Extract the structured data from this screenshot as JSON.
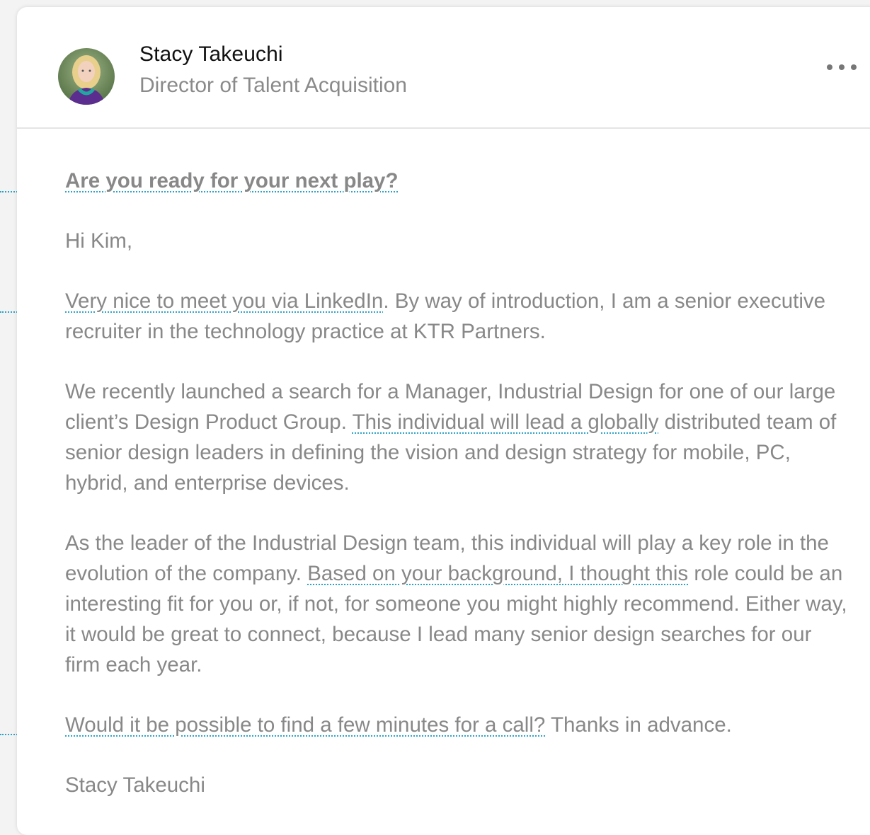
{
  "sender": {
    "name": "Stacy Takeuchi",
    "title": "Director of Talent Acquisition"
  },
  "menu": {
    "icon": "more-horizontal-icon"
  },
  "message": {
    "subject": "Are you ready for your next play?",
    "greeting": "Hi Kim,",
    "p1_highlight": "Very nice to meet you via LinkedIn",
    "p1_rest": ". By way of introduction, I am a senior executive recruiter in the technology practice at KTR Partners.",
    "p2_start": "We recently launched a search for a Manager, Industrial Design for one of our large client’s Design Product Group. ",
    "p2_highlight": "This individual will lead a globally",
    "p2_rest": " distributed team of senior design leaders in defining the vision and design strategy for mobile, PC, hybrid, and enterprise devices.",
    "p3_start": "As the leader of the Industrial Design team, this individual will play a key role in the evolution of the company. ",
    "p3_highlight": "Based on your background, I thought this",
    "p3_rest": " role could be an interesting fit for you or, if not, for someone you might highly recommend. Either way, it would be great to connect, because I lead many senior design searches for our firm each year.",
    "p4_highlight": "Would it be possible to find a few minutes for a call?",
    "p4_rest": " Thanks in advance.",
    "signature": "Stacy Takeuchi"
  },
  "colors": {
    "annotation": "#2aa3c9",
    "body_text": "#888888",
    "name_text": "#111111"
  }
}
